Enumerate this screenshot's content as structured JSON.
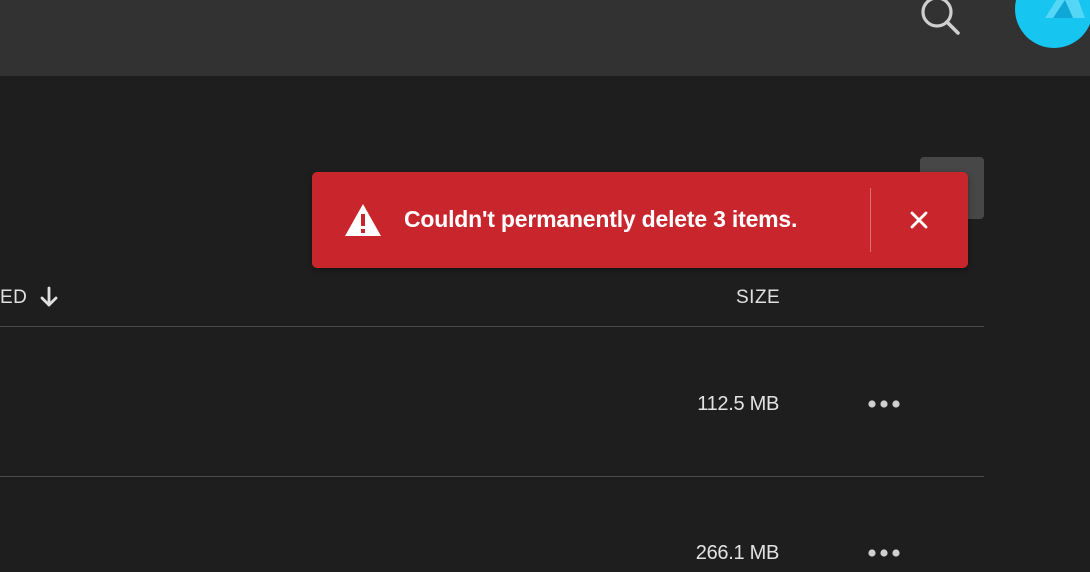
{
  "header": {
    "search_icon": "search-icon",
    "avatar_icon": "avatar",
    "colors": {
      "bar": "#323232",
      "avatar": "#16c5f0"
    }
  },
  "toast": {
    "message": "Couldn't permanently delete 3 items.",
    "icon": "warning-icon",
    "close_icon": "close-icon",
    "color": "#c9252d"
  },
  "table": {
    "columns": {
      "modified_label": "ED",
      "sort_icon": "arrow-down-icon",
      "size_label": "SIZE"
    },
    "rows": [
      {
        "size": "112.5 MB",
        "more_icon": "more-icon"
      },
      {
        "size": "266.1 MB",
        "more_icon": "more-icon"
      }
    ]
  }
}
